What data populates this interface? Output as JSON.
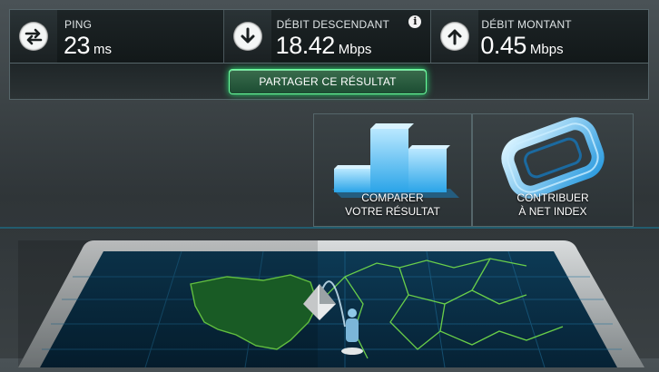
{
  "stats": {
    "ping": {
      "label": "PING",
      "value": "23",
      "unit": "ms",
      "icon": "transfer-arrows-icon"
    },
    "download": {
      "label": "DÉBIT DESCENDANT",
      "value": "18.42",
      "unit": "Mbps",
      "icon": "arrow-down-icon",
      "info": "i"
    },
    "upload": {
      "label": "DÉBIT MONTANT",
      "value": "0.45",
      "unit": "Mbps",
      "icon": "arrow-up-icon"
    }
  },
  "share": {
    "label": "PARTAGER CE RÉSULTAT",
    "color": "#2fe077"
  },
  "cards": {
    "compare": {
      "line1": "COMPARER",
      "line2": "VOTRE RÉSULTAT",
      "icon": "bar-chart-icon"
    },
    "contribute": {
      "line1": "CONTRIBUER",
      "line2": "À NET INDEX",
      "icon": "net-index-icon"
    }
  },
  "colors": {
    "accent": "#00c8ff",
    "map_land": "#1e6b2c",
    "map_border": "#74e04a"
  }
}
